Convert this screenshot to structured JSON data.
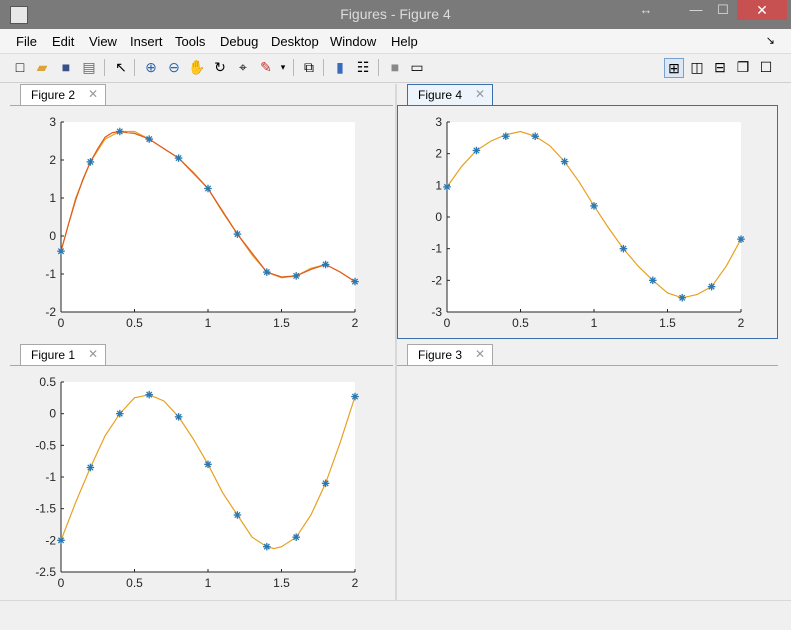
{
  "window": {
    "title": "Figures - Figure 4",
    "close_symbol": "✕",
    "max_symbol": "☐",
    "min_symbol": "—",
    "move_symbol": "↔"
  },
  "menu": [
    "File",
    "Edit",
    "View",
    "Insert",
    "Tools",
    "Debug",
    "Desktop",
    "Window",
    "Help"
  ],
  "menu_extra": "↘",
  "toolbar": {
    "icons": [
      "new-figure-icon",
      "open-file-icon",
      "save-icon",
      "print-icon",
      "pointer-icon",
      "zoom-in-icon",
      "zoom-out-icon",
      "pan-icon",
      "rotate-icon",
      "data-cursor-icon",
      "brush-icon",
      "dropdown-icon",
      "link-plot-icon",
      "colorbar-icon",
      "legend-icon",
      "hide-plot-tools-icon",
      "show-plot-tools-icon",
      "tile-icon",
      "left-right-icon",
      "top-bottom-icon",
      "float-icon",
      "maximize-icon"
    ]
  },
  "panels": [
    {
      "id": "p2",
      "tab_label": "Figure 2",
      "close": "✕"
    },
    {
      "id": "p4",
      "tab_label": "Figure 4",
      "close": "✕"
    },
    {
      "id": "p1",
      "tab_label": "Figure 1",
      "close": "✕"
    },
    {
      "id": "p3",
      "tab_label": "Figure 3",
      "close": "✕"
    }
  ],
  "chart_data": [
    {
      "panel": "Figure 2",
      "type": "line",
      "xlim": [
        0,
        2
      ],
      "ylim": [
        -2,
        3
      ],
      "xticks": [
        "0",
        "0.5",
        "1",
        "1.5",
        "2"
      ],
      "yticks": [
        "-2",
        "-1",
        "0",
        "1",
        "2",
        "3"
      ],
      "colors": {
        "markers": "#2a78b0",
        "curve": "#e8a020",
        "curve2": "#e05a20"
      },
      "series": [
        {
          "style": "markers",
          "x": [
            0,
            0.2,
            0.4,
            0.6,
            0.8,
            1.0,
            1.2,
            1.4,
            1.6,
            1.8,
            2.0
          ],
          "y": [
            -0.4,
            1.95,
            2.75,
            2.55,
            2.05,
            1.25,
            0.05,
            -0.95,
            -1.05,
            -0.75,
            -1.2
          ]
        },
        {
          "style": "curve",
          "x": [
            0,
            0.1,
            0.2,
            0.3,
            0.4,
            0.5,
            0.6,
            0.7,
            0.8,
            0.9,
            1.0,
            1.1,
            1.2,
            1.3,
            1.4,
            1.5,
            1.6,
            1.7,
            1.8,
            1.9,
            2.0
          ],
          "y": [
            -0.4,
            1.0,
            1.95,
            2.55,
            2.75,
            2.75,
            2.55,
            2.3,
            2.05,
            1.68,
            1.25,
            0.62,
            0.05,
            -0.5,
            -0.95,
            -1.1,
            -1.05,
            -0.85,
            -0.75,
            -0.95,
            -1.2
          ]
        },
        {
          "style": "curve2",
          "x": [
            0,
            0.05,
            0.1,
            0.15,
            0.2,
            0.25,
            0.3,
            0.35,
            0.4,
            0.45,
            0.5,
            0.6,
            0.8,
            1.0,
            1.2,
            1.4,
            1.5,
            1.6,
            1.7,
            1.8,
            1.9,
            2.0
          ],
          "y": [
            -0.4,
            0.3,
            0.95,
            1.5,
            1.95,
            2.3,
            2.6,
            2.72,
            2.75,
            2.72,
            2.7,
            2.55,
            2.05,
            1.25,
            0.05,
            -0.95,
            -1.08,
            -1.05,
            -0.88,
            -0.75,
            -0.95,
            -1.2
          ]
        }
      ]
    },
    {
      "panel": "Figure 4",
      "type": "line",
      "xlim": [
        0,
        2
      ],
      "ylim": [
        -3,
        3
      ],
      "xticks": [
        "0",
        "0.5",
        "1",
        "1.5",
        "2"
      ],
      "yticks": [
        "-3",
        "-2",
        "-1",
        "0",
        "1",
        "2",
        "3"
      ],
      "colors": {
        "markers": "#2a78b0",
        "curve": "#e8a020"
      },
      "series": [
        {
          "style": "markers",
          "x": [
            0,
            0.2,
            0.4,
            0.6,
            0.8,
            1.0,
            1.2,
            1.4,
            1.6,
            1.8,
            2.0
          ],
          "y": [
            0.95,
            2.1,
            2.55,
            2.55,
            1.75,
            0.35,
            -1.0,
            -2.0,
            -2.55,
            -2.2,
            -0.7
          ]
        },
        {
          "style": "curve",
          "x": [
            0,
            0.1,
            0.2,
            0.3,
            0.4,
            0.5,
            0.6,
            0.7,
            0.8,
            0.9,
            1.0,
            1.1,
            1.2,
            1.3,
            1.4,
            1.5,
            1.6,
            1.7,
            1.8,
            1.9,
            2.0
          ],
          "y": [
            0.95,
            1.6,
            2.1,
            2.4,
            2.6,
            2.7,
            2.55,
            2.25,
            1.75,
            1.1,
            0.35,
            -0.35,
            -1.0,
            -1.55,
            -2.0,
            -2.4,
            -2.55,
            -2.45,
            -2.2,
            -1.55,
            -0.7
          ]
        }
      ]
    },
    {
      "panel": "Figure 1",
      "type": "line",
      "xlim": [
        0,
        2
      ],
      "ylim": [
        -2.5,
        0.5
      ],
      "xticks": [
        "0",
        "0.5",
        "1",
        "1.5",
        "2"
      ],
      "yticks": [
        "-2.5",
        "-2",
        "-1.5",
        "-1",
        "-0.5",
        "0",
        "0.5"
      ],
      "colors": {
        "markers": "#2a78b0",
        "curve": "#e8a020"
      },
      "series": [
        {
          "style": "markers",
          "x": [
            0,
            0.2,
            0.4,
            0.6,
            0.8,
            1.0,
            1.2,
            1.4,
            1.6,
            1.8,
            2.0
          ],
          "y": [
            -2.0,
            -0.85,
            0.0,
            0.3,
            -0.05,
            -0.8,
            -1.6,
            -2.1,
            -1.95,
            -1.1,
            0.27
          ]
        },
        {
          "style": "curve",
          "x": [
            0,
            0.1,
            0.2,
            0.3,
            0.4,
            0.5,
            0.6,
            0.7,
            0.8,
            0.9,
            1.0,
            1.1,
            1.2,
            1.3,
            1.4,
            1.45,
            1.5,
            1.6,
            1.7,
            1.8,
            1.9,
            2.0
          ],
          "y": [
            -2.0,
            -1.4,
            -0.85,
            -0.35,
            0.0,
            0.25,
            0.3,
            0.2,
            -0.05,
            -0.4,
            -0.8,
            -1.25,
            -1.6,
            -1.95,
            -2.1,
            -2.13,
            -2.1,
            -1.95,
            -1.6,
            -1.1,
            -0.45,
            0.27
          ]
        }
      ]
    }
  ]
}
